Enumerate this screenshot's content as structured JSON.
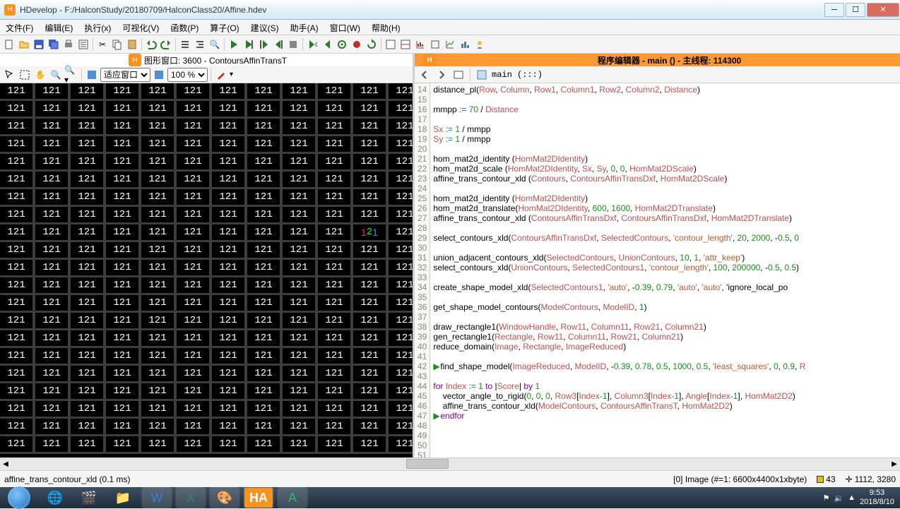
{
  "title": "HDevelop - F:/HalconStudy/20180709/HalconClass20/Affine.hdev",
  "menubar": [
    "文件(F)",
    "编辑(E)",
    "执行(x)",
    "可视化(V)",
    "函数(P)",
    "算子(O)",
    "建议(S)",
    "助手(A)",
    "窗口(W)",
    "帮助(H)"
  ],
  "graphic_header": "图形窗口: 3600 - ContoursAffinTransT",
  "zoom_mode": "适应窗口",
  "zoom_pct": "100 %",
  "editor_header": "程序编辑器 - main () - 主线程: 114300",
  "prg_title": "main (:::)",
  "grid_value": "121",
  "code_lines": [
    {
      "n": 14,
      "t": "distance_pl(Row, Column, Row1, Column1, Row2, Column2, Distance)"
    },
    {
      "n": 15,
      "t": ""
    },
    {
      "n": 16,
      "t": "mmpp := 70 / Distance"
    },
    {
      "n": 17,
      "t": ""
    },
    {
      "n": 18,
      "t": "Sx := 1 / mmpp"
    },
    {
      "n": 19,
      "t": "Sy := 1 / mmpp"
    },
    {
      "n": 20,
      "t": ""
    },
    {
      "n": 21,
      "t": "hom_mat2d_identity (HomMat2DIdentity)"
    },
    {
      "n": 22,
      "t": "hom_mat2d_scale (HomMat2DIdentity, Sx, Sy, 0, 0, HomMat2DScale)"
    },
    {
      "n": 23,
      "t": "affine_trans_contour_xld (Contours, ContoursAffinTransDxf, HomMat2DScale)"
    },
    {
      "n": 24,
      "t": ""
    },
    {
      "n": 25,
      "t": "hom_mat2d_identity (HomMat2DIdentity)"
    },
    {
      "n": 26,
      "t": "hom_mat2d_translate(HomMat2DIdentity, 600, 1600, HomMat2DTranslate)"
    },
    {
      "n": 27,
      "t": "affine_trans_contour_xld (ContoursAffinTransDxf, ContoursAffinTransDxf, HomMat2DTranslate)"
    },
    {
      "n": 28,
      "t": ""
    },
    {
      "n": 29,
      "t": "select_contours_xld(ContoursAffinTransDxf, SelectedContours, 'contour_length', 20, 2000, -0.5, 0"
    },
    {
      "n": 30,
      "t": ""
    },
    {
      "n": 31,
      "t": "union_adjacent_contours_xld(SelectedContours, UnionContours, 10, 1, 'attr_keep')"
    },
    {
      "n": 32,
      "t": "select_contours_xld(UnionContours, SelectedContours1, 'contour_length', 100, 200000, -0.5, 0.5)"
    },
    {
      "n": 33,
      "t": ""
    },
    {
      "n": 34,
      "t": "create_shape_model_xld(SelectedContours1, 'auto', -0.39, 0.79, 'auto', 'auto', 'ignore_local_po"
    },
    {
      "n": 35,
      "t": ""
    },
    {
      "n": 36,
      "t": "get_shape_model_contours(ModelContours, ModelID, 1)"
    },
    {
      "n": 37,
      "t": ""
    },
    {
      "n": 38,
      "t": "draw_rectangle1(WindowHandle, Row11, Column11, Row21, Column21)"
    },
    {
      "n": 39,
      "t": "gen_rectangle1(Rectangle, Row11, Column11, Row21, Column21)"
    },
    {
      "n": 40,
      "t": "reduce_domain(Image, Rectangle, ImageReduced)"
    },
    {
      "n": 41,
      "t": ""
    },
    {
      "n": 42,
      "t": "find_shape_model(ImageReduced, ModelID, -0.39, 0.78, 0.5, 1000, 0.5, 'least_squares', 0, 0.9, R",
      "ip": true
    },
    {
      "n": 43,
      "t": ""
    },
    {
      "n": 44,
      "t": "for Index := 1 to |Score| by 1"
    },
    {
      "n": 45,
      "t": "    vector_angle_to_rigid(0, 0, 0, Row3[Index-1], Column3[Index-1], Angle[Index-1], HomMat2D2)"
    },
    {
      "n": 46,
      "t": "    affine_trans_contour_xld(ModelContours, ContoursAffinTransT, HomMat2D2)"
    },
    {
      "n": 47,
      "t": "endfor",
      "pc": true
    },
    {
      "n": 48,
      "t": ""
    },
    {
      "n": 49,
      "t": ""
    },
    {
      "n": 50,
      "t": ""
    },
    {
      "n": 51,
      "t": ""
    }
  ],
  "status_left": "affine_trans_contour_xld (0.1 ms)",
  "status_image": "[0] Image (#=1: 6600x4400x1xbyte)",
  "status_count": "43",
  "status_pos": "1112, 3280",
  "clock_time": "9:53",
  "clock_date": "2018/8/10"
}
